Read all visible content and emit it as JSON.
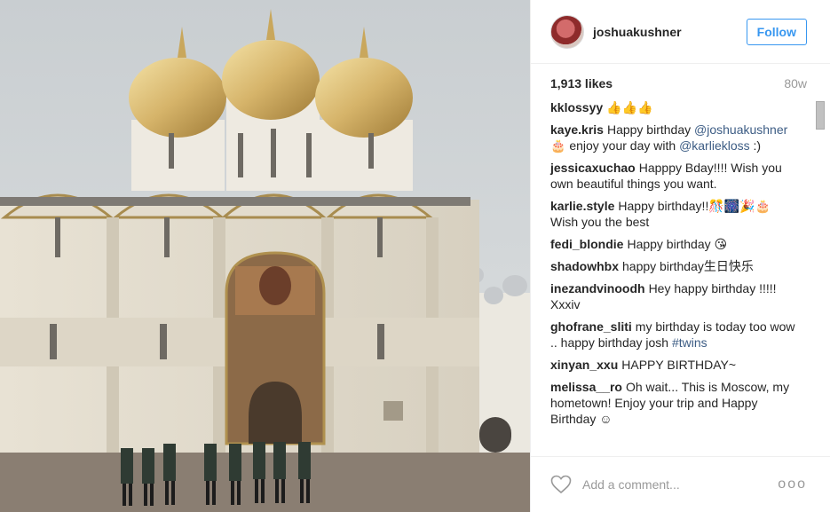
{
  "header": {
    "username": "joshuakushner",
    "follow_label": "Follow"
  },
  "stats": {
    "likes": "1,913 likes",
    "time": "80w"
  },
  "comments": [
    {
      "user": "kklossyy",
      "text": "👍👍👍"
    },
    {
      "user": "kaye.kris",
      "text": "Happy birthday",
      "tag1": "@joshuakushner",
      "mid": " 🎂 enjoy your day with ",
      "tag2": "@karliekloss",
      "end": " :)"
    },
    {
      "user": "jessicaxuchao",
      "text": "Happpy Bday!!!! Wish you own beautiful things you want."
    },
    {
      "user": "karlie.style",
      "text": "Happy birthday!!🎊🎆🎉🎂 Wish you the best"
    },
    {
      "user": "fedi_blondie",
      "text": "Happy birthday 😘"
    },
    {
      "user": "shadowhbx",
      "text": "happy birthday生日快乐"
    },
    {
      "user": "inezandvinoodh",
      "text": "Hey happy birthday !!!!! Xxxiv"
    },
    {
      "user": "ghofrane_sliti",
      "text": "my birthday is today too wow .. happy birthday josh",
      "tag": "#twins"
    },
    {
      "user": "xinyan_xxu",
      "text": "HAPPY BIRTHDAY~"
    },
    {
      "user": "melissa__ro",
      "text": "Oh wait... This is Moscow, my hometown! Enjoy your trip and Happy Birthday ☺"
    }
  ],
  "comment_box": {
    "placeholder": "Add a comment...",
    "more": "ooo"
  },
  "colors": {
    "link": "#3c5c84",
    "follow": "#3897f0",
    "muted": "#999999"
  }
}
